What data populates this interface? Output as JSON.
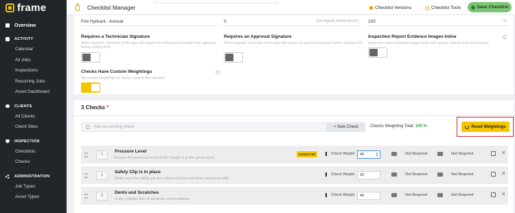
{
  "brand": {
    "name": "frame"
  },
  "sidebar": {
    "overview": "Overview",
    "sections": [
      {
        "title": "ACTIVITY",
        "items": [
          "Calendar",
          "All Jobs",
          "Inspections",
          "Recurring Jobs",
          "Asset Dashboard"
        ]
      },
      {
        "title": "CLIENTS",
        "items": [
          "All Clients",
          "Client Sites"
        ]
      },
      {
        "title": "INSPECTION",
        "items": [
          "Checklists",
          "Checks"
        ]
      },
      {
        "title": "ADMINISTRATION",
        "items": [
          "Job Types",
          "Asset Types"
        ]
      }
    ]
  },
  "topbar": {
    "title": "Checklist Manager",
    "versions": "Checklist Versions",
    "tools": "Checklist Tools",
    "save": "Save Checklist"
  },
  "form": {
    "name_value": "Fire Hydrant - Annual",
    "repeat_value": "0",
    "repeat_placeholder": "(no repeat instructions)",
    "percent_value": "100",
    "percent_unit": "%",
    "tech_sig": {
      "label": "Requires a Technician Signature",
      "hint": "When required, checklists of this type will require the technician to provide their signature before closing it off."
    },
    "approval_sig": {
      "label": "Requires an Approval Signature",
      "hint": "When required, checklists of this type will require an approval signature before closing it off."
    },
    "evidence": {
      "label": "Inspection Report Evidence Images Inline",
      "hint": "Inspection report evidence images inline with answer instead of at end of report."
    },
    "custom_weight": {
      "label": "Checks Have Custom Weightings",
      "hint": "Set custom weightings for checks used in this checklist."
    }
  },
  "checks": {
    "title": "3 Checks",
    "required_mark": "*",
    "add_placeholder": "Add an existing check",
    "new_check": "+ New Check",
    "weight_total_label": "Checks Weighting Total:",
    "weight_total_value": "100 %",
    "reset": "Reset Weightings",
    "weight_label": "Check Weight",
    "not_required": "Not Required",
    "instant_fail": "Instant Fail",
    "rows": [
      {
        "n": "1",
        "name": "Pressure Level",
        "desc": "Ensure the pressure level of the Gauge is in the green zone",
        "weight": "40"
      },
      {
        "n": "2",
        "name": "Safety Clip is in place",
        "desc": "Make sure the safety pin is in place and has not been tampered with",
        "weight": "20"
      },
      {
        "n": "3",
        "name": "Dents and Scratches",
        "desc": "Is the cylinder free of all dents and scratches",
        "weight": "40"
      }
    ]
  }
}
